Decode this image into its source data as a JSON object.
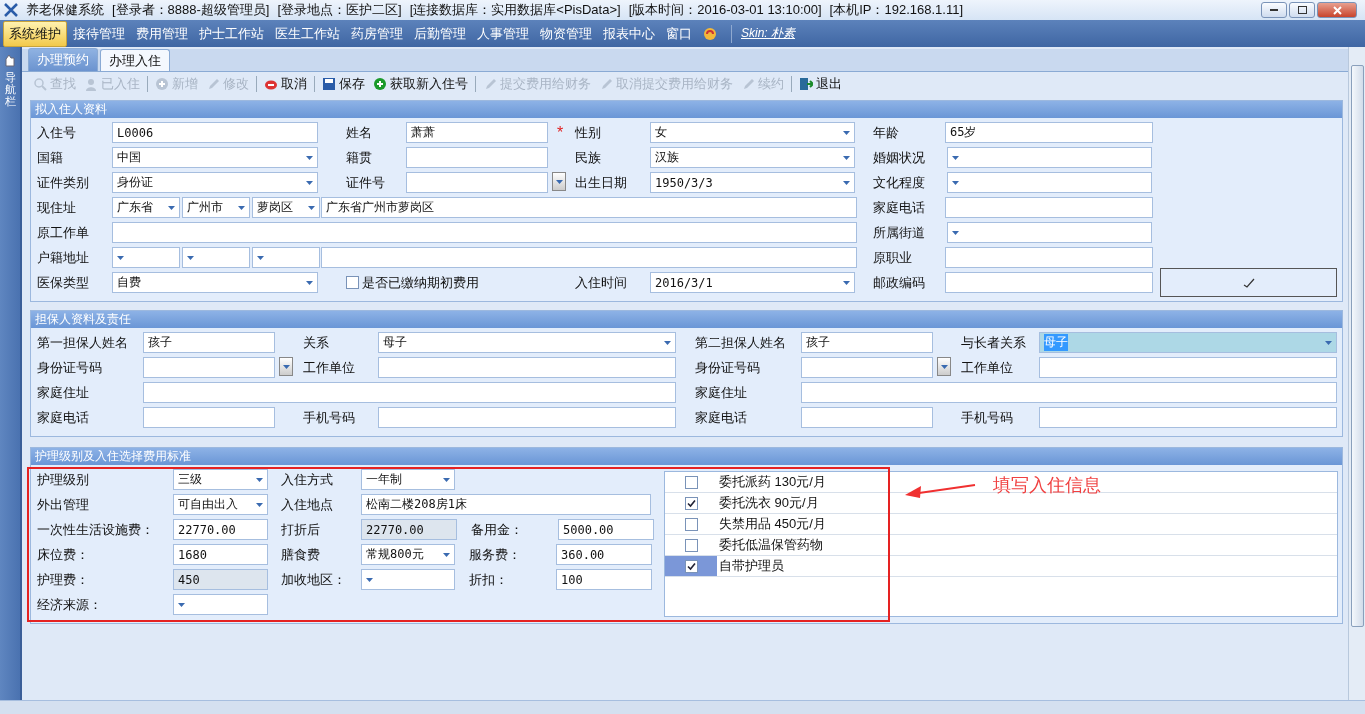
{
  "title_bar": {
    "segments": [
      "养老保健系统",
      "[登录者：8888-超级管理员]",
      "[登录地点：医护二区]",
      "[连接数据库：实用数据库<PisData>]",
      "[版本时间：2016-03-01 13:10:00]",
      "[本机IP：192.168.1.11]"
    ]
  },
  "menu": {
    "items": [
      {
        "label": "系统维护",
        "selected": true
      },
      {
        "label": "接待管理",
        "selected": false
      },
      {
        "label": "费用管理",
        "selected": false
      },
      {
        "label": "护士工作站",
        "selected": false
      },
      {
        "label": "医生工作站",
        "selected": false
      },
      {
        "label": "药房管理",
        "selected": false
      },
      {
        "label": "后勤管理",
        "selected": false
      },
      {
        "label": "人事管理",
        "selected": false
      },
      {
        "label": "物资管理",
        "selected": false
      },
      {
        "label": "报表中心",
        "selected": false
      },
      {
        "label": "窗口",
        "selected": false
      }
    ],
    "skin": "Skin: 朴素"
  },
  "sidebar": {
    "label": "导航栏"
  },
  "tabs": [
    {
      "label": "办理预约",
      "selected": false
    },
    {
      "label": "办理入住",
      "selected": true
    }
  ],
  "toolbar": [
    {
      "label": "查找",
      "disabled": true
    },
    {
      "label": "已入住",
      "disabled": true
    },
    {
      "label": "新增",
      "disabled": true
    },
    {
      "label": "修改",
      "disabled": true
    },
    {
      "label": "取消",
      "disabled": false
    },
    {
      "label": "保存",
      "disabled": false
    },
    {
      "label": "获取新入住号",
      "disabled": false
    },
    {
      "label": "提交费用给财务",
      "disabled": true
    },
    {
      "label": "取消提交费用给财务",
      "disabled": true
    },
    {
      "label": "续约",
      "disabled": true
    },
    {
      "label": "退出",
      "disabled": false
    }
  ],
  "applicant": {
    "title": "拟入住人资料",
    "rows": [
      [
        {
          "label": "入住号",
          "inputs": [
            {
              "kind": "text",
              "value": "L0006"
            }
          ]
        },
        {
          "label": "姓名",
          "inputs": [
            {
              "kind": "text",
              "value": "萧萧"
            }
          ]
        },
        {
          "required_mark": "*",
          "label": "性别",
          "inputs": [
            {
              "kind": "combo",
              "value": "女"
            }
          ]
        },
        {
          "label": "年龄",
          "inputs": [
            {
              "kind": "text",
              "value": "65岁"
            }
          ]
        }
      ],
      [
        {
          "label": "国籍",
          "inputs": [
            {
              "kind": "combo",
              "value": "中国"
            }
          ]
        },
        {
          "label": "籍贯",
          "inputs": [
            {
              "kind": "text"
            }
          ]
        },
        {
          "label": "民族",
          "inputs": [
            {
              "kind": "combo",
              "value": "汉族"
            }
          ]
        },
        {
          "label": "婚姻状况",
          "inputs": [
            {
              "kind": "combo"
            }
          ]
        }
      ],
      [
        {
          "label": "证件类别",
          "inputs": [
            {
              "kind": "combo",
              "value": "身份证"
            }
          ]
        },
        {
          "label": "证件号",
          "inputs": [
            {
              "kind": "idbox"
            }
          ]
        },
        {
          "label": "出生日期",
          "inputs": [
            {
              "kind": "combo",
              "value": "1950/3/3"
            }
          ]
        },
        {
          "label": "文化程度",
          "inputs": [
            {
              "kind": "combo"
            }
          ]
        }
      ],
      [
        {
          "label": "现住址",
          "inputs": [
            {
              "kind": "combo",
              "value": "广东省"
            },
            {
              "kind": "combo",
              "value": "广州市"
            },
            {
              "kind": "combo",
              "value": "萝岗区"
            },
            {
              "kind": "text",
              "value": "广东省广州市萝岗区"
            }
          ]
        },
        {
          "label": "家庭电话",
          "inputs": [
            {
              "kind": "text"
            }
          ]
        }
      ],
      [
        {
          "label": "原工作单",
          "inputs": [
            {
              "kind": "text"
            }
          ]
        },
        {
          "label": "所属街道",
          "inputs": [
            {
              "kind": "combo"
            }
          ]
        }
      ],
      [
        {
          "label": "户籍地址",
          "inputs": [
            {
              "kind": "combo"
            },
            {
              "kind": "combo"
            },
            {
              "kind": "combo"
            },
            {
              "kind": "text"
            }
          ]
        },
        {
          "label": "原职业",
          "inputs": [
            {
              "kind": "text"
            }
          ]
        }
      ],
      [
        {
          "label": "医保类型",
          "inputs": [
            {
              "kind": "combo",
              "value": "自费"
            }
          ]
        },
        {
          "checkbox": {
            "text": "是否已缴纳期初费用",
            "checked": false
          }
        },
        {
          "label": "入住时间",
          "inputs": [
            {
              "kind": "combo",
              "value": "2016/3/1"
            }
          ]
        },
        {
          "label": "邮政编码",
          "inputs": [
            {
              "kind": "text"
            }
          ]
        },
        {
          "inputs": [
            {
              "kind": "confirm"
            }
          ]
        }
      ]
    ]
  },
  "guarantor": {
    "title": "担保人资料及责任",
    "columns": [
      {
        "rows": [
          [
            {
              "label": "第一担保人姓名",
              "inputs": [
                {
                  "kind": "text",
                  "value": "孩子"
                }
              ]
            },
            {
              "label": "关系",
              "inputs": [
                {
                  "kind": "combo",
                  "value": "母子"
                }
              ]
            }
          ],
          [
            {
              "label": "身份证号码",
              "inputs": [
                {
                  "kind": "idbox"
                }
              ]
            },
            {
              "label": "工作单位",
              "inputs": [
                {
                  "kind": "text"
                }
              ]
            }
          ],
          [
            {
              "label": "家庭住址",
              "inputs": [
                {
                  "kind": "text"
                }
              ]
            }
          ],
          [
            {
              "label": "家庭电话",
              "inputs": [
                {
                  "kind": "text"
                }
              ]
            },
            {
              "label": "手机号码",
              "inputs": [
                {
                  "kind": "text"
                }
              ]
            }
          ]
        ]
      },
      {
        "rows": [
          [
            {
              "label": "第二担保人姓名",
              "inputs": [
                {
                  "kind": "text",
                  "value": "孩子"
                }
              ]
            },
            {
              "label": "与长者关系",
              "inputs": [
                {
                  "kind": "combo",
                  "value": "母子",
                  "highlighted": true
                }
              ]
            }
          ],
          [
            {
              "label": "身份证号码",
              "inputs": [
                {
                  "kind": "idbox"
                }
              ]
            },
            {
              "label": "工作单位",
              "inputs": [
                {
                  "kind": "text"
                }
              ]
            }
          ],
          [
            {
              "label": "家庭住址",
              "inputs": [
                {
                  "kind": "text"
                }
              ]
            }
          ],
          [
            {
              "label": "家庭电话",
              "inputs": [
                {
                  "kind": "text"
                }
              ]
            },
            {
              "label": "手机号码",
              "inputs": [
                {
                  "kind": "text"
                }
              ]
            }
          ]
        ]
      }
    ]
  },
  "fees": {
    "title": "护理级别及入住选择费用标准",
    "rows": [
      [
        {
          "label": "护理级别",
          "inputs": [
            {
              "kind": "combo",
              "value": "三级"
            }
          ]
        },
        {
          "label": "入住方式",
          "inputs": [
            {
              "kind": "combo",
              "value": "一年制"
            }
          ]
        }
      ],
      [
        {
          "label": "外出管理",
          "inputs": [
            {
              "kind": "combo",
              "value": "可自由出入"
            }
          ]
        },
        {
          "label": "入住地点",
          "inputs": [
            {
              "kind": "text",
              "value": "松南二楼208房1床"
            }
          ]
        }
      ],
      [
        {
          "label": "一次性生活设施费：",
          "inputs": [
            {
              "kind": "text",
              "value": "22770.00"
            }
          ]
        },
        {
          "label": "打折后",
          "inputs": [
            {
              "kind": "readonly",
              "value": "22770.00"
            }
          ]
        },
        {
          "label": "备用金：",
          "inputs": [
            {
              "kind": "text",
              "value": "5000.00"
            }
          ]
        }
      ],
      [
        {
          "label": "床位费：",
          "inputs": [
            {
              "kind": "text",
              "value": "1680"
            }
          ]
        },
        {
          "label": "膳食费",
          "inputs": [
            {
              "kind": "combo",
              "value": "常规800元"
            }
          ]
        },
        {
          "label": "服务费：",
          "inputs": [
            {
              "kind": "text",
              "value": "360.00"
            }
          ]
        }
      ],
      [
        {
          "label": "护理费：",
          "inputs": [
            {
              "kind": "readonly",
              "value": "450"
            }
          ]
        },
        {
          "label": "加收地区：",
          "inputs": [
            {
              "kind": "combo"
            }
          ]
        },
        {
          "label": "折扣：",
          "inputs": [
            {
              "kind": "text",
              "value": "100"
            }
          ]
        }
      ],
      [
        {
          "label": "经济来源：",
          "inputs": [
            {
              "kind": "combo"
            }
          ]
        }
      ]
    ],
    "services": [
      {
        "label": "委托派药 130元/月",
        "checked": false,
        "selected": false
      },
      {
        "label": "委托洗衣 90元/月",
        "checked": true,
        "selected": false
      },
      {
        "label": "失禁用品 450元/月",
        "checked": false,
        "selected": false
      },
      {
        "label": "委托低温保管药物",
        "checked": false,
        "selected": false
      },
      {
        "label": "自带护理员",
        "checked": true,
        "selected": true
      }
    ]
  },
  "annotation": {
    "text": "填写入住信息"
  }
}
